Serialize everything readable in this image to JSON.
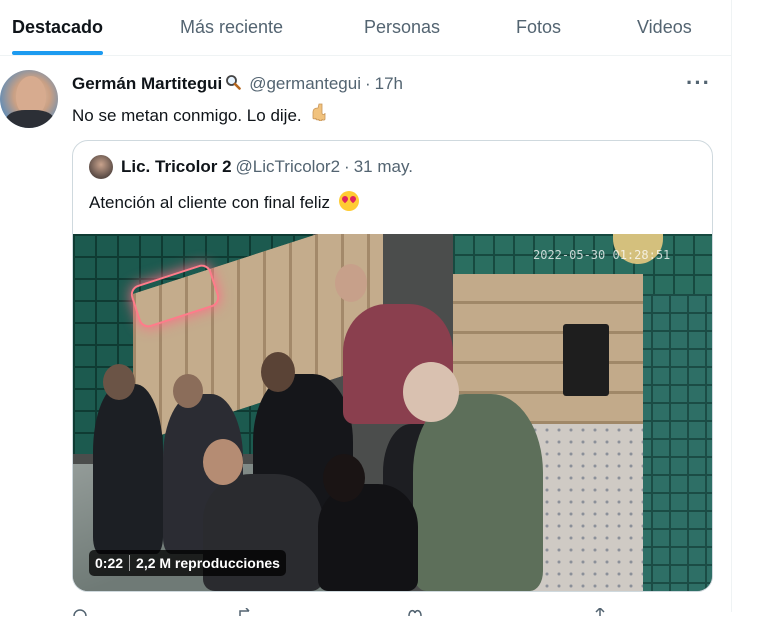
{
  "tabs": [
    {
      "label": "Destacado",
      "active": true
    },
    {
      "label": "Más reciente",
      "active": false
    },
    {
      "label": "Personas",
      "active": false
    },
    {
      "label": "Fotos",
      "active": false
    },
    {
      "label": "Videos",
      "active": false
    }
  ],
  "tweet": {
    "name": "Germán Martitegui",
    "name_icon": "magnifying-glass",
    "handle": "@germantegui",
    "separator": "·",
    "time": "17h",
    "text": "No se metan conmigo. Lo dije.",
    "text_emoji": "backhand-pointing-down",
    "more_label": "···"
  },
  "quote": {
    "name": "Lic. Tricolor 2",
    "handle": "@LicTricolor2",
    "separator": "·",
    "date": "31 may.",
    "text": "Atención al cliente con final feliz",
    "text_emoji": "smiling-face-with-heart-eyes",
    "video": {
      "duration": "0:22",
      "views": "2,2 M reproducciones",
      "timestamp_overlay": "2022-05-30 01:28:51"
    }
  },
  "colors": {
    "accent": "#1d9bf0",
    "text_primary": "#0f1419",
    "text_secondary": "#536471",
    "border": "#cfd9de"
  }
}
